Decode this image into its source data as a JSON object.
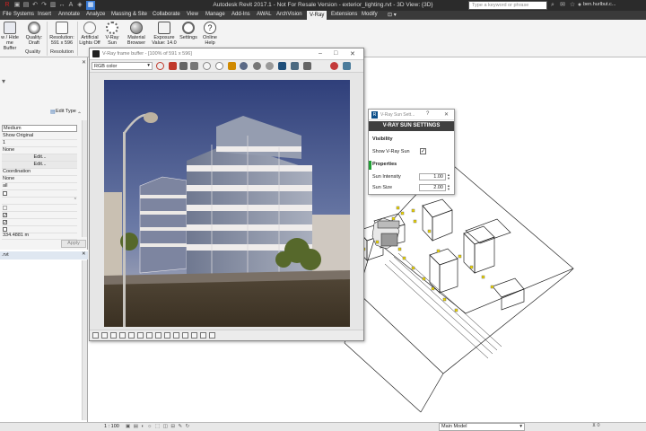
{
  "titlebar": {
    "title": "Autodesk Revit 2017.1 -  Not For Resale Version -     exterior_lighting.rvt - 3D View: {3D}",
    "search_placeholder": "Type a keyword or phrase",
    "user": "ben.hurlbut.c..."
  },
  "menu": {
    "tabs": [
      "File",
      "Systems",
      "Insert",
      "Annotate",
      "Analyze",
      "Massing & Site",
      "Collaborate",
      "View",
      "Manage",
      "Add-Ins",
      "AWAL",
      "ArchVision",
      "V-Ray",
      "Extensions",
      "Modify"
    ],
    "active": "V-Ray"
  },
  "ribbon": {
    "buttons": [
      {
        "l1": "w / Hide",
        "l2": "me Buffer",
        "icon": "frame-buffer-icon",
        "color": "#8a8fa0"
      },
      {
        "l1": "Quality:",
        "l2": "Draft",
        "icon": "quality-icon",
        "color": "#b1b1b1"
      },
      {
        "l1": "Resolution:",
        "l2": "591 x 596",
        "icon": "resolution-icon",
        "color": "#9a9a9a"
      },
      {
        "l1": "Artificial",
        "l2": "Lights Off",
        "icon": "lights-icon",
        "color": "#c9c9c9"
      },
      {
        "l1": "V-Ray",
        "l2": "Sun",
        "icon": "sun-icon",
        "color": "#d4d4d4"
      },
      {
        "l1": "Material",
        "l2": "Browser",
        "icon": "material-icon",
        "color": "#a8a8a8"
      },
      {
        "l1": "Exposure",
        "l2": "Value: 14.0",
        "icon": "exposure-icon",
        "color": "#9b9b9b"
      },
      {
        "l1": "Settings",
        "l2": "",
        "icon": "gear-icon",
        "color": "#a0a0a0"
      },
      {
        "l1": "Online",
        "l2": "Help",
        "icon": "help-icon",
        "color": "#a0a0a0"
      }
    ],
    "groups": [
      "Quality",
      "Resolution"
    ]
  },
  "properties": {
    "edit_type": "Edit Type",
    "rows": [
      "Medium",
      "Show Original",
      "1",
      "None",
      "Edit...",
      "Edit...",
      "Coordination",
      "None",
      "all",
      "",
      "",
      "",
      "",
      "",
      "334.4881 m"
    ],
    "apply": "Apply"
  },
  "browser": {
    "title": ".rvt"
  },
  "statusbar": {
    "scale": "1 : 100",
    "model": "Main Model"
  },
  "vfb": {
    "title": "V-Ray frame buffer - [100% of 591 x 596]",
    "channel": "RGB color",
    "toolbar_colors": [
      "#c0392b",
      "#c0392b",
      "#555",
      "#666",
      "#777",
      "#f4f4f4",
      "#9aa3b8",
      "#d08a00",
      "#777",
      "#9a9a9a",
      "#1f4f7a",
      "#4d6b82",
      "#666",
      "#c43a3a",
      "#4b7c9c"
    ]
  },
  "sun": {
    "window_title": "V-Ray Sun Sett...",
    "header": "V-RAY SUN SETTINGS",
    "visibility_section": "Visibility",
    "show_label": "Show V-Ray Sun",
    "show_checked": "✓",
    "properties_section": "Properties",
    "intensity_label": "Sun Intensity",
    "intensity": "1.00",
    "size_label": "Sun Size",
    "size": "2.00"
  }
}
